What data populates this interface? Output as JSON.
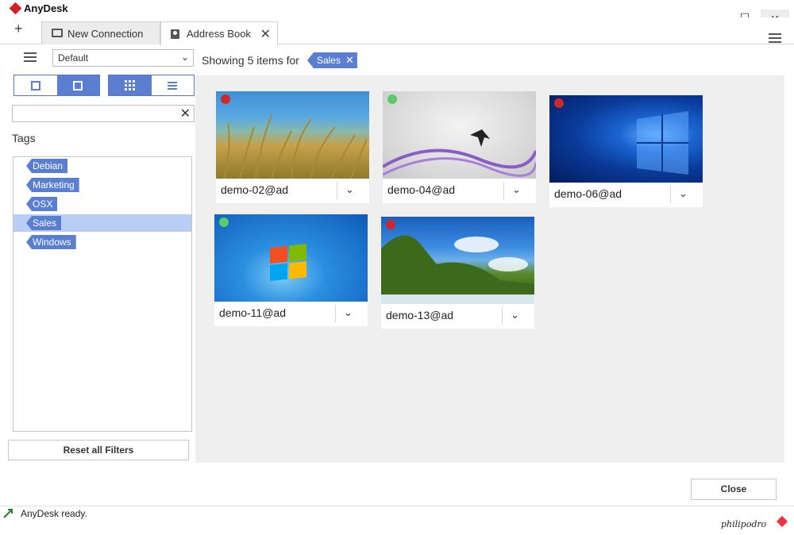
{
  "app": {
    "title": "AnyDesk"
  },
  "tabs": {
    "new_tab_glyph": "+",
    "items": [
      {
        "label": "New Connection",
        "icon": "monitor-icon",
        "active": false
      },
      {
        "label": "Address Book",
        "icon": "address-book-icon",
        "active": true
      }
    ],
    "close_glyph": "✕"
  },
  "window_controls": {
    "minimize": "—",
    "maximize": "☐",
    "close": "✕"
  },
  "sidebar": {
    "address_book_select": {
      "value": "Default"
    },
    "search": {
      "value": "",
      "placeholder": ""
    },
    "tags_heading": "Tags",
    "tags": [
      {
        "label": "Debian",
        "selected": false
      },
      {
        "label": "Marketing",
        "selected": false
      },
      {
        "label": "OSX",
        "selected": false
      },
      {
        "label": "Sales",
        "selected": true
      },
      {
        "label": "Windows",
        "selected": false
      }
    ],
    "reset_label": "Reset all Filters"
  },
  "filter": {
    "showing_text": "Showing 5 items for",
    "active_tag": "Sales",
    "remove_glyph": "✕"
  },
  "cards": [
    {
      "label": "demo-02@ad",
      "status": "offline",
      "status_color": "#cc2a2a"
    },
    {
      "label": "demo-04@ad",
      "status": "online",
      "status_color": "#5cc96b"
    },
    {
      "label": "demo-06@ad",
      "status": "offline",
      "status_color": "#cc2a2a"
    },
    {
      "label": "demo-11@ad",
      "status": "online",
      "status_color": "#5cc96b"
    },
    {
      "label": "demo-13@ad",
      "status": "offline",
      "status_color": "#cc2a2a"
    }
  ],
  "footer": {
    "close_label": "Close"
  },
  "statusbar": {
    "text": "AnyDesk ready.",
    "watermark": "philipodro"
  },
  "colors": {
    "accent": "#5a7fd1",
    "selected_tag_bg": "#b8cef5",
    "brand_red": "#d51f26"
  }
}
